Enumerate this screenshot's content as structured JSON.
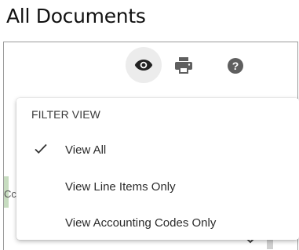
{
  "page": {
    "title": "All Documents"
  },
  "toolbar": {
    "view_icon": "eye-icon",
    "print_icon": "printer-icon",
    "help_icon": "help-icon",
    "help_glyph": "?"
  },
  "filter_menu": {
    "header": "FILTER VIEW",
    "items": [
      {
        "label": "View All",
        "selected": true
      },
      {
        "label": "View Line Items Only",
        "selected": false
      },
      {
        "label": "View Accounting Codes Only",
        "selected": false
      }
    ]
  },
  "background": {
    "clipped_text": "Cc"
  },
  "colors": {
    "active_icon_bg": "#ececec",
    "icon": "#5f5f5f",
    "strip": "#c7dcc0"
  }
}
